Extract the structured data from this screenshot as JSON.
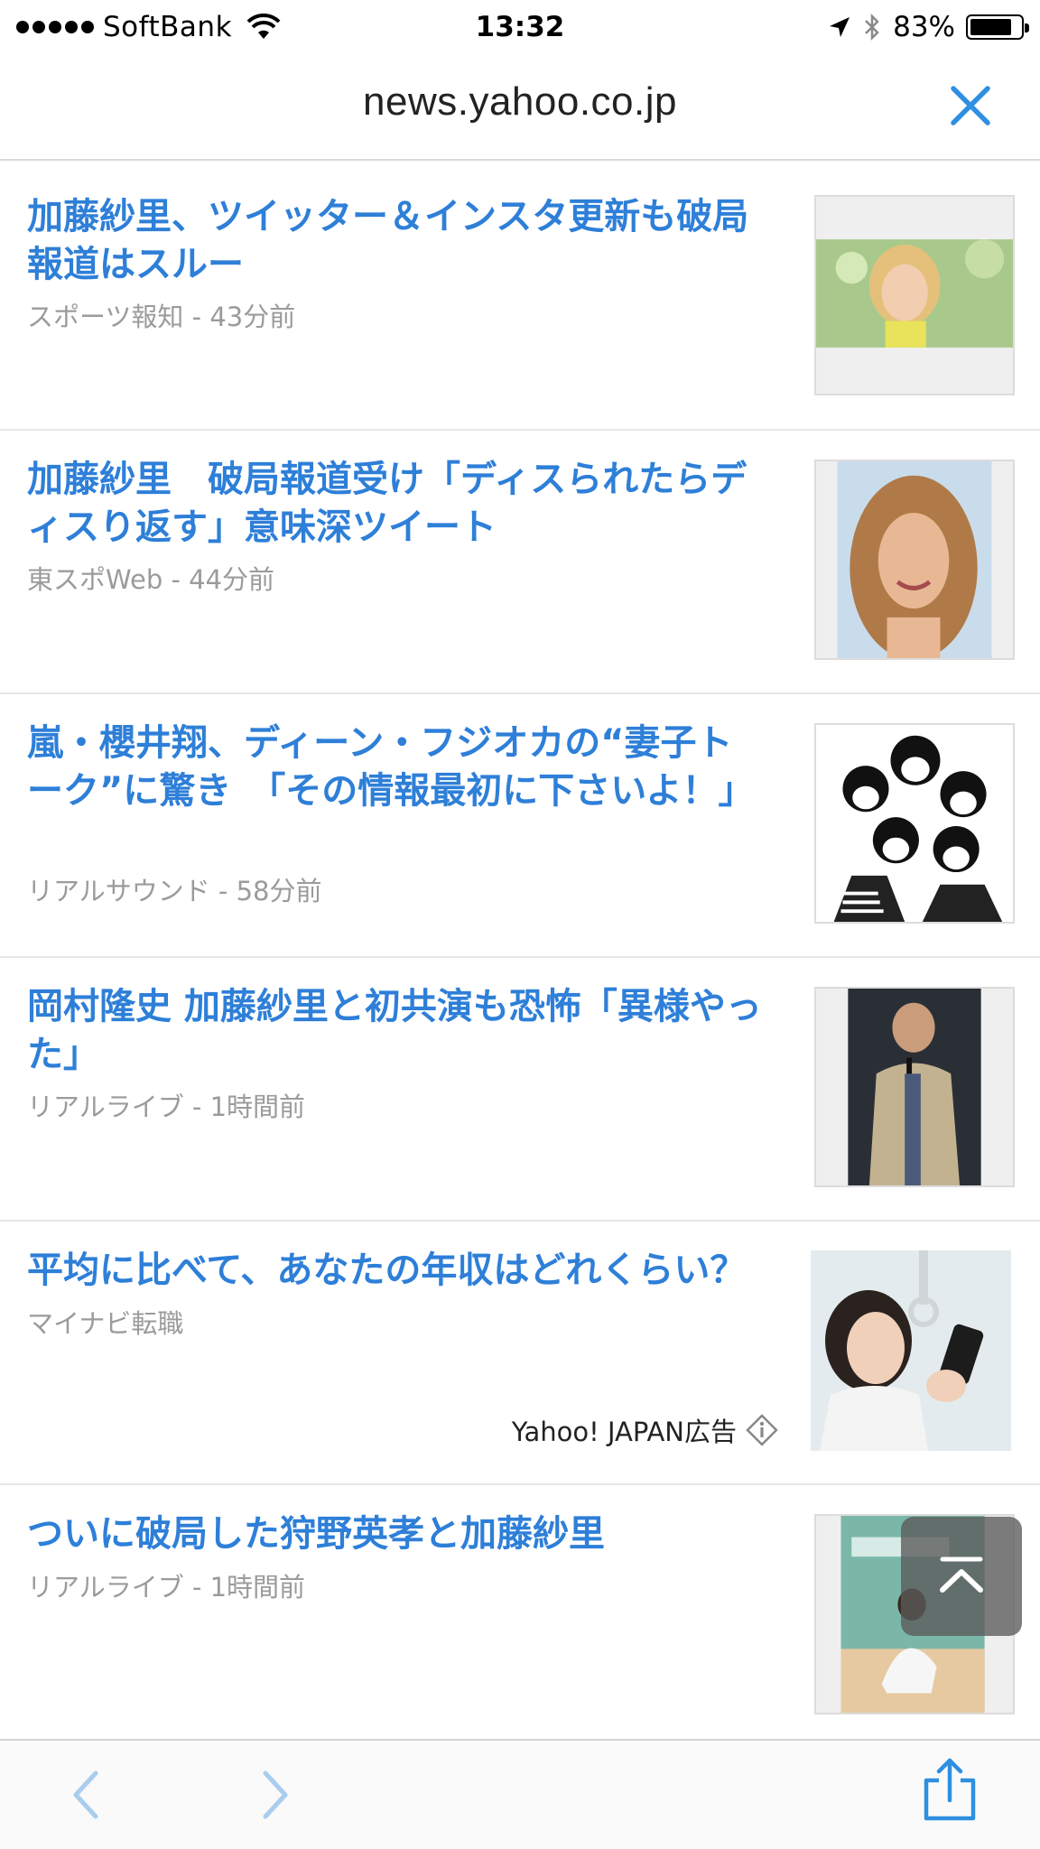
{
  "status_bar": {
    "carrier": "SoftBank",
    "time": "13:32",
    "battery_percent": "83%",
    "battery_level": 0.83
  },
  "url_bar": {
    "domain": "news.yahoo.co.jp",
    "close_icon": "close-icon"
  },
  "colors": {
    "link_blue": "#2e7fd8",
    "meta_gray": "#9b9b9b",
    "ios_blue": "#2f8fe0"
  },
  "articles": [
    {
      "title": "加藤紗里、ツイッター＆インスタ更新も破局報道はスルー",
      "source": "スポーツ報知 - 43分前",
      "thumbnail": "woman-blonde-photo"
    },
    {
      "title": "加藤紗里　破局報道受け「ディスられたらディスり返す」意味深ツイート",
      "source": "東スポWeb - 44分前",
      "thumbnail": "woman-portrait-photo"
    },
    {
      "title": "嵐・櫻井翔、ディーン・フジオカの“妻子トーク”に驚き　「その情報最初に下さいよ！」",
      "source": "リアルサウンド - 58分前",
      "thumbnail": "group-illustration"
    },
    {
      "title": "岡村隆史 加藤紗里と初共演も恐怖「異様やった」",
      "source": "リアルライブ - 1時間前",
      "thumbnail": "man-microphone-photo"
    },
    {
      "title": "平均に比べて、あなたの年収はどれくらい？",
      "source": "マイナビ転職",
      "ad_label": "Yahoo! JAPAN広告",
      "thumbnail": "woman-phone-ad-photo"
    },
    {
      "title": "ついに破局した狩野英孝と加藤紗里",
      "source": "リアルライブ - 1時間前",
      "thumbnail": "stage-event-photo"
    }
  ],
  "toolbar": {
    "back_icon": "chevron-left-icon",
    "forward_icon": "chevron-right-icon",
    "share_icon": "share-icon"
  }
}
